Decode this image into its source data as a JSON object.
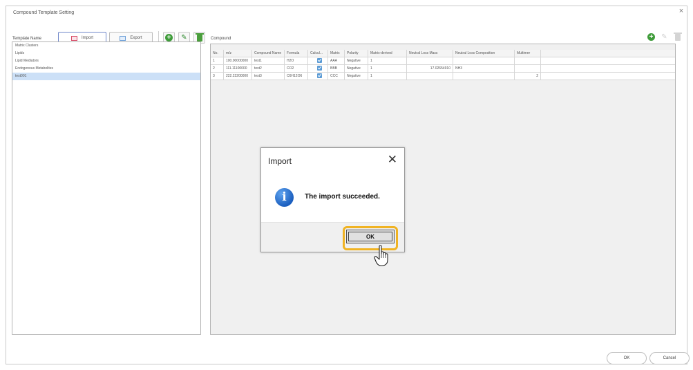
{
  "window": {
    "title": "Compound Template Setting",
    "close_glyph": "×"
  },
  "template_panel": {
    "label": "Template Name",
    "import_label": "Import",
    "export_label": "Export",
    "items": [
      {
        "label": "Matrix Clusters"
      },
      {
        "label": "Lipids"
      },
      {
        "label": "Lipid Mediators"
      },
      {
        "label": "Endogenous Metabolites"
      },
      {
        "label": "test001",
        "selected": true
      }
    ]
  },
  "compound_panel": {
    "label": "Compound",
    "columns": [
      "No.",
      "m/z",
      "Compound Name",
      "Formula",
      "Calcul...",
      "Matrix",
      "Polarity",
      "Matrix-derived",
      "Neutral Loss Mass",
      "Neutral Loss Composition",
      "Multimer"
    ],
    "rows": [
      {
        "no": "1",
        "mz": "100.00000000",
        "name": "test1",
        "formula": "H2O",
        "calc": true,
        "matrix": "AAA",
        "polarity": "Negative",
        "matrix_derived": "1",
        "nl_mass": "",
        "nl_comp": "",
        "multimer": ""
      },
      {
        "no": "2",
        "mz": "111.11100000",
        "name": "test2",
        "formula": "CO2",
        "calc": true,
        "matrix": "BBB",
        "polarity": "Negative",
        "matrix_derived": "1",
        "nl_mass": "17.02654910",
        "nl_comp": "NH3",
        "multimer": ""
      },
      {
        "no": "3",
        "mz": "222.22200000",
        "name": "test3",
        "formula": "C6H12O6",
        "calc": true,
        "matrix": "CCC",
        "polarity": "Negative",
        "matrix_derived": "1",
        "nl_mass": "",
        "nl_comp": "",
        "multimer": "2"
      }
    ]
  },
  "dialog": {
    "title": "Import",
    "close_glyph": "✕",
    "message": "The import succeeded.",
    "ok_label": "OK",
    "info_glyph": "i"
  },
  "footer": {
    "ok_label": "OK",
    "cancel_label": "Cancel"
  },
  "colors": {
    "highlight": "#f0b323",
    "add": "#3f9c3a",
    "selection": "#cce0f7",
    "info": "#1c5fbf"
  }
}
